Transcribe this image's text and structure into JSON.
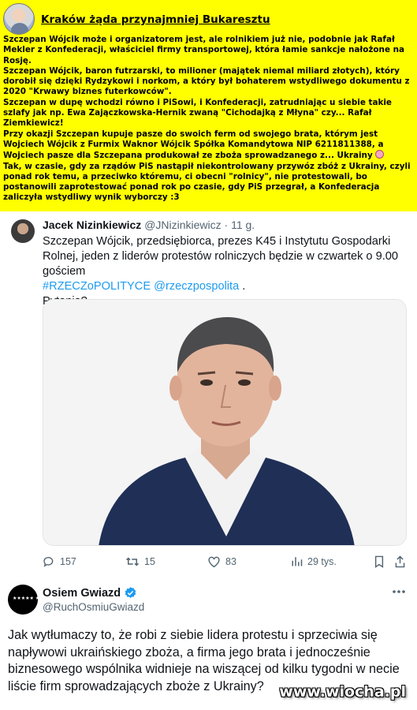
{
  "header_post": {
    "title": "Kraków żąda przynajmniej Bukaresztu",
    "paragraphs": [
      "Szczepan Wójcik może i organizatorem jest, ale rolnikiem już nie, podobnie jak Rafał Mekler z Konfederacji, właściciel firmy transportowej, która łamie sankcje nałożone na Rosję.",
      "Szczepan Wójcik, baron futrzarski, to milioner (majątek niemal miliard złotych), który dorobił się dzięki Rydzykowi i norkom, a który był bohaterem wstydliwego dokumentu z 2020 \"Krwawy biznes futerkowców\".",
      "Szczepan w dupę wchodzi równo i PiSowi, i Konfederacji, zatrudniając u siebie takie szlafy jak np. Ewa Zajączkowska-Hernik zwaną \"Cichodajką z Młyna\" czy... Rafał Ziemkiewicz!",
      "Przy okazji Szczepan kupuje pasze do swoich ferm od swojego brata, którym jest Wojciech Wójcik z Furmix Waknor Wójcik Spółka Komandytowa NIP 6211811388, a Wojciech pasze dla Szczepana produkował ze zboża sprowadzanego z... Ukrainy",
      "Tak, w czasie, gdy za rządów PiS nastąpił niekontrolowany przywóz zbóż z Ukrainy, czyli ponad rok temu, a przeciwko któremu, ci obecni \"rolnicy\", nie protestowali, bo postanowili zaprotestować ponad rok po czasie, gdy PiS przegrał, a Konfederacja zaliczyła wstydliwy wynik wyborczy :3"
    ]
  },
  "tweet1": {
    "name": "Jacek Nizinkiewicz",
    "handle": "@JNizinkiewicz",
    "time": "· 11 g.",
    "text_1": "Szczepan Wójcik, przedsiębiorca, prezes K45 i Instytutu Gospodarki Rolnej, jeden z liderów protestów rolniczych będzie w czwartek o 9.00 gościem",
    "hashtag": "#RZECZoPOLITYCE",
    "mention": "@rzeczpospolita",
    "text_end": " .",
    "text_2": "Pytania?",
    "replies": "157",
    "reposts": "15",
    "likes": "83",
    "views": "29 tys."
  },
  "tweet2": {
    "name": "Osiem Gwiazd",
    "handle": "@RuchOsmiuGwiazd",
    "text": "Jak wytłumaczy to, że robi z siebie lidera protestu i sprzeciwia się napływowi ukraińskiego zboża, a firma jego brata i jednocześnie biznesowego wspólnika widnieje na wiszącej od kilku tygodni w necie liście firm sprowadzających zboże z Ukrainy?"
  },
  "watermark": "www.wiocha.pl",
  "colors": {
    "banner_yellow": "#ffff00",
    "link_blue": "#1d9bf0",
    "verified_blue": "#1d9bf0",
    "muted_gray": "#536471"
  },
  "icons": [
    "reply-icon",
    "repost-icon",
    "like-icon",
    "views-icon",
    "bookmark-icon",
    "share-icon",
    "verified-badge-icon",
    "more-icon"
  ]
}
